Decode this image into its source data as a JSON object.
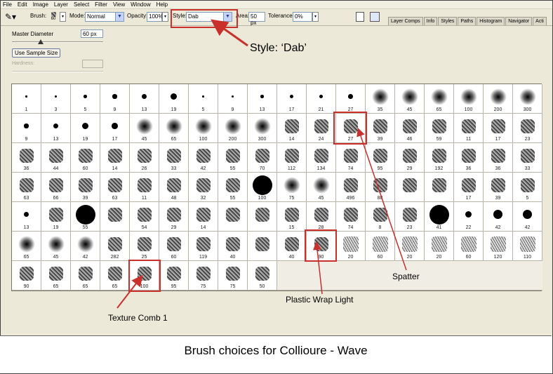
{
  "menu": [
    "File",
    "Edit",
    "Image",
    "Layer",
    "Select",
    "Filter",
    "View",
    "Window",
    "Help"
  ],
  "options": {
    "brush_label": "Brush:",
    "brush_size": "60",
    "mode_label": "Mode:",
    "mode_value": "Normal",
    "opacity_label": "Opacity:",
    "opacity_value": "100%",
    "style_label": "Style:",
    "style_value": "Dab",
    "area_label": "Area:",
    "area_value": "50 px",
    "tolerance_label": "Tolerance:",
    "tolerance_value": "0%"
  },
  "tabs": [
    "Layer Comps",
    "Info",
    "Styles",
    "Paths",
    "Histogram",
    "Navigator",
    "Acti"
  ],
  "panel": {
    "master_diameter_label": "Master Diameter",
    "master_diameter_value": "60 px",
    "use_sample_size": "Use Sample Size",
    "hardness_label": "Hardness:"
  },
  "brushes": [
    [
      "1",
      "3",
      "5",
      "9",
      "13",
      "19",
      "5",
      "9",
      "13",
      "17",
      "21",
      "27",
      "35",
      "45",
      "65",
      "100",
      "200",
      "300"
    ],
    [
      "9",
      "13",
      "19",
      "17",
      "45",
      "65",
      "100",
      "200",
      "300",
      "14",
      "24",
      "27",
      "39",
      "46",
      "59",
      "11",
      "17",
      "23"
    ],
    [
      "36",
      "44",
      "60",
      "14",
      "26",
      "33",
      "42",
      "55",
      "70",
      "112",
      "134",
      "74",
      "95",
      "29",
      "192",
      "36",
      "36",
      "33"
    ],
    [
      "63",
      "66",
      "39",
      "63",
      "11",
      "48",
      "32",
      "55",
      "100",
      "75",
      "45",
      "496",
      "88",
      "",
      "",
      "17",
      "39",
      "5"
    ],
    [
      "13",
      "19",
      "55",
      "",
      "54",
      "29",
      "14",
      "",
      "",
      "15",
      "28",
      "74",
      "8",
      "23",
      "41",
      "22",
      "42",
      "42"
    ],
    [
      "65",
      "45",
      "42",
      "282",
      "25",
      "60",
      "119",
      "40",
      "",
      "40",
      "90",
      "20",
      "60",
      "20",
      "20",
      "60",
      "120",
      "110"
    ],
    [
      "90",
      "65",
      "65",
      "65",
      "100",
      "95",
      "75",
      "75",
      "50"
    ]
  ],
  "annotations": {
    "style": "Style: ‘Dab’",
    "spatter": "Spatter",
    "plastic": "Plastic Wrap Light",
    "texture": "Texture Comb 1"
  },
  "caption": "Brush choices for Collioure - Wave",
  "colors": {
    "highlight": "#c9302c",
    "ui_bg": "#ece9d8"
  }
}
